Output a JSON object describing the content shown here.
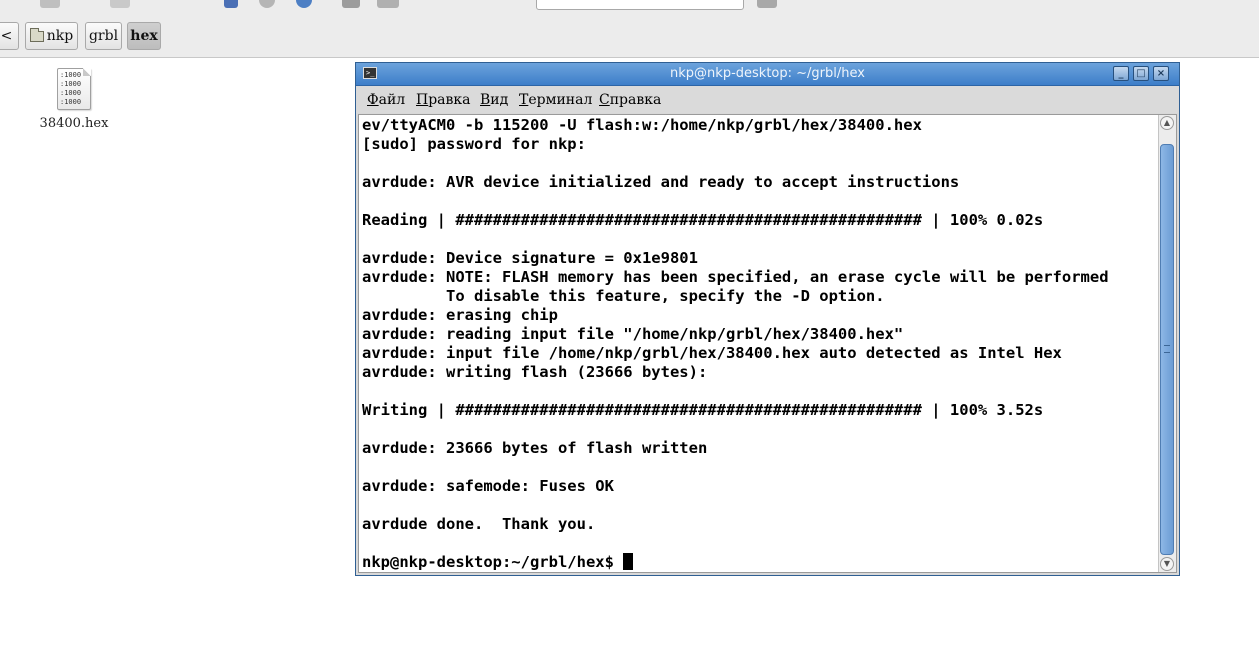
{
  "file_manager": {
    "path_buttons": [
      {
        "label": "nkp",
        "has_folder_icon": true
      },
      {
        "label": "grbl"
      },
      {
        "label": "hex",
        "active": true
      }
    ],
    "back_arrow": "<",
    "file": {
      "name": "38400.hex",
      "icon": "hex-file-icon",
      "icon_text": ":1000\n:1000\n:1000\n:1000"
    }
  },
  "terminal": {
    "title": "nkp@nkp-desktop: ~/grbl/hex",
    "controls": {
      "minimize": "_",
      "maximize": "□",
      "close": "×"
    },
    "menu": [
      {
        "label": "Файл",
        "mnemonic": "Ф",
        "rest": "айл"
      },
      {
        "label": "Правка",
        "mnemonic": "П",
        "rest": "равка"
      },
      {
        "label": "Вид",
        "mnemonic": "В",
        "rest": "ид"
      },
      {
        "label": "Терминал",
        "mnemonic": "Т",
        "rest": "ерминал"
      },
      {
        "label": "Справка",
        "mnemonic": "С",
        "rest": "правка"
      }
    ],
    "lines": [
      "ev/ttyACM0 -b 115200 -U flash:w:/home/nkp/grbl/hex/38400.hex",
      "[sudo] password for nkp:",
      "",
      "avrdude: AVR device initialized and ready to accept instructions",
      "",
      "Reading | ################################################## | 100% 0.02s",
      "",
      "avrdude: Device signature = 0x1e9801",
      "avrdude: NOTE: FLASH memory has been specified, an erase cycle will be performed",
      "         To disable this feature, specify the -D option.",
      "avrdude: erasing chip",
      "avrdude: reading input file \"/home/nkp/grbl/hex/38400.hex\"",
      "avrdude: input file /home/nkp/grbl/hex/38400.hex auto detected as Intel Hex",
      "avrdude: writing flash (23666 bytes):",
      "",
      "Writing | ################################################## | 100% 3.52s",
      "",
      "avrdude: 23666 bytes of flash written",
      "",
      "avrdude: safemode: Fuses OK",
      "",
      "avrdude done.  Thank you.",
      ""
    ],
    "prompt": "nkp@nkp-desktop:~/grbl/hex$ ",
    "scrollbar": {
      "up": "▲",
      "down": "▼",
      "grip": "≡"
    }
  },
  "colors": {
    "titlebar": "#4a89d0",
    "terminal_bg": "#ffffff",
    "terminal_fg": "#000000",
    "panel_bg": "#ececec"
  }
}
